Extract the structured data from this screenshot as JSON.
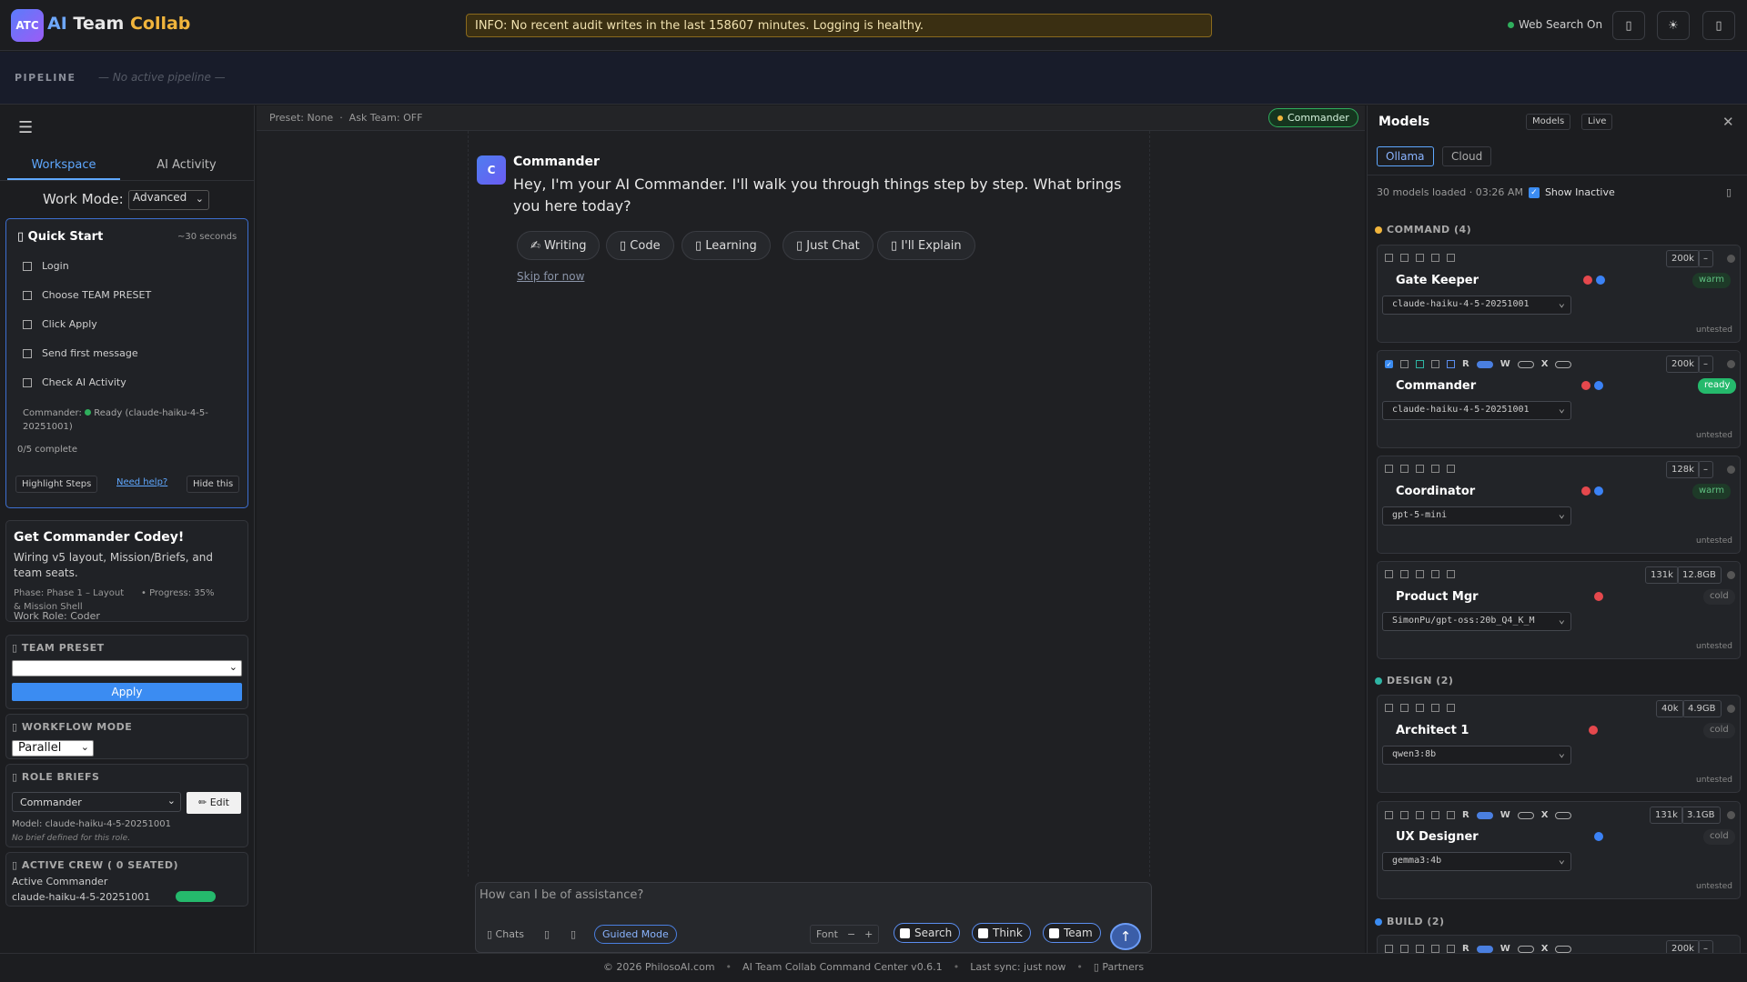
{
  "header": {
    "logo_badge": "ATC",
    "title_parts": [
      "AI",
      " Team",
      " Collab"
    ],
    "info_banner": "INFO: No recent audit writes in the last 158607 minutes. Logging is healthy.",
    "web_search": "Web Search On",
    "buttons": [
      "▯",
      "☀",
      "▯"
    ]
  },
  "pipeline": {
    "label": "PIPELINE",
    "status": "— No active pipeline —"
  },
  "sidebar": {
    "hamburger": "☰",
    "tabs": [
      "Workspace",
      "AI Activity"
    ],
    "work_mode_label": "Work Mode:",
    "work_mode_value": "Advanced",
    "quick_start": {
      "title": "▯ Quick Start",
      "time": "~30 seconds",
      "items": [
        "Login",
        "Choose TEAM PRESET",
        "Click Apply",
        "Send first message",
        "Check AI Activity"
      ],
      "status_prefix": "Commander:",
      "status_text": "Ready (claude-haiku-4-5-20251001)",
      "complete": "0/5 complete",
      "highlight": "Highlight Steps",
      "help": "Need help?",
      "hide": "Hide this"
    },
    "codey": {
      "title": "Get Commander Codey!",
      "desc": "Wiring v5 layout, Mission/Briefs, and team seats.",
      "phase": "Phase: Phase 1 – Layout & Mission Shell",
      "progress": "• Progress: 35%",
      "role": "Work Role: Coder"
    },
    "team_preset": {
      "title": "▯ TEAM PRESET",
      "apply": "Apply"
    },
    "workflow": {
      "title": "▯ WORKFLOW MODE",
      "value": "Parallel"
    },
    "role_briefs": {
      "title": "▯ ROLE BRIEFS",
      "value": "Commander",
      "edit": "✏ Edit",
      "model": "Model: claude-haiku-4-5-20251001",
      "note": "No brief defined for this role."
    },
    "crew": {
      "title": "▯ ACTIVE CREW ( 0 SEATED)",
      "label": "Active Commander",
      "model": "claude-haiku-4-5-20251001"
    }
  },
  "center": {
    "preset_info": "Preset: None  ·  Ask Team: OFF",
    "badge": "Commander",
    "message": {
      "avatar": "C",
      "author": "Commander",
      "text": "Hey, I'm your AI Commander. I'll walk you through things step by step. What brings you here today?"
    },
    "chips": [
      "✍ Writing",
      "▯ Code",
      "▯ Learning",
      "▯ Just Chat",
      "▯ I'll Explain"
    ],
    "skip": "Skip for now",
    "composer": {
      "placeholder": "How can I be of assistance?",
      "chats": "▯ Chats",
      "icon1": "▯",
      "icon2": "▯",
      "guided": "Guided Mode",
      "font_label": "Font",
      "font_minus": "−",
      "font_plus": "+",
      "search": "Search",
      "think": "Think",
      "team": "Team",
      "send": "↑"
    }
  },
  "models": {
    "title": "Models",
    "view_tabs": [
      "Models",
      "Live"
    ],
    "close": "✕",
    "sources": [
      "Ollama",
      "Cloud"
    ],
    "info": "30 models loaded · 03:26 AM",
    "show_inactive": "Show Inactive",
    "side_icon": "▯",
    "groups": [
      {
        "title": "COMMAND (4)",
        "color": "#f0b43c"
      },
      {
        "title": "DESIGN (2)",
        "color": "#2fb5a4"
      },
      {
        "title": "BUILD (2)",
        "color": "#3b8cf2"
      }
    ],
    "cards": [
      {
        "name": "Gate Keeper",
        "ctx": [
          "200k",
          "–"
        ],
        "model": "claude-haiku-4-5-20251001",
        "state": "warm",
        "untested": "untested"
      },
      {
        "name": "Commander",
        "ctx": [
          "200k",
          "–"
        ],
        "model": "claude-haiku-4-5-20251001",
        "state": "ready",
        "untested": "untested"
      },
      {
        "name": "Coordinator",
        "ctx": [
          "128k",
          "–"
        ],
        "model": "gpt-5-mini",
        "state": "warm",
        "untested": "untested"
      },
      {
        "name": "Product Mgr",
        "ctx": [
          "131k",
          "12.8GB"
        ],
        "model": "SimonPu/gpt-oss:20b_Q4_K_M",
        "state": "cold",
        "untested": "untested"
      },
      {
        "name": "Architect 1",
        "ctx": [
          "40k",
          "4.9GB"
        ],
        "model": "qwen3:8b",
        "state": "cold",
        "untested": "untested"
      },
      {
        "name": "UX Designer",
        "ctx": [
          "131k",
          "3.1GB"
        ],
        "model": "gemma3:4b",
        "state": "cold",
        "untested": "untested"
      }
    ],
    "rwx": [
      "R",
      "W",
      "X"
    ],
    "last_ctx": [
      "200k",
      "–"
    ]
  },
  "footer": {
    "items": [
      "© 2026 PhilosoAI.com",
      "AI Team Collab Command Center v0.6.1",
      "Last sync: just now",
      "▯ Partners"
    ]
  }
}
